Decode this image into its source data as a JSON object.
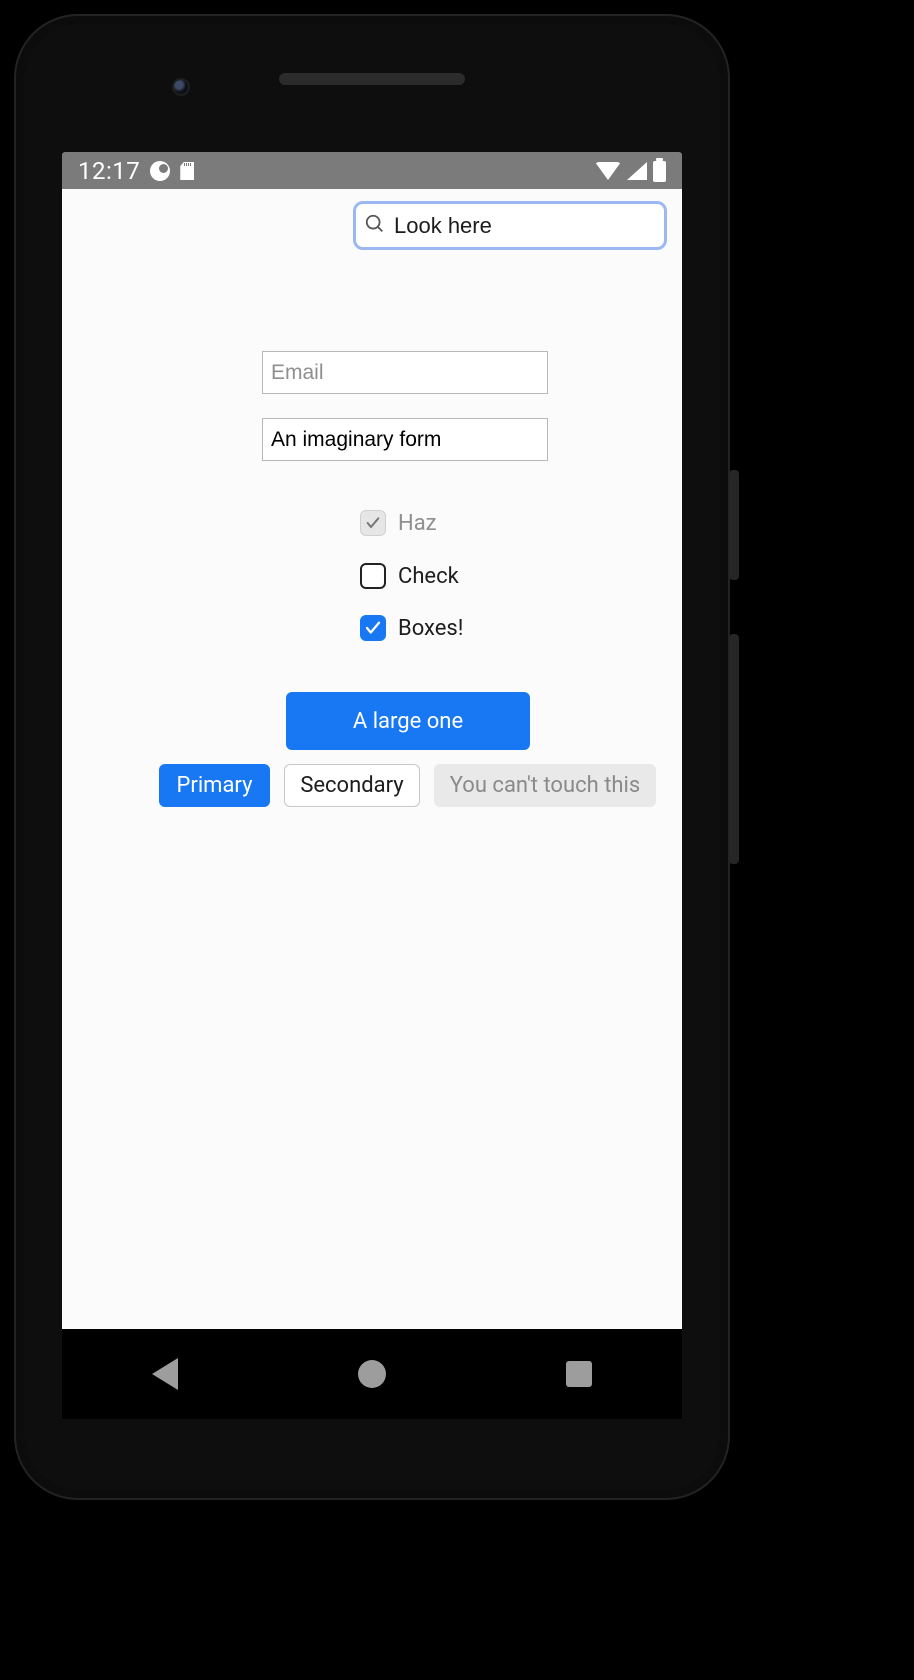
{
  "status": {
    "time": "12:17"
  },
  "search": {
    "value": "Look here"
  },
  "form": {
    "email_placeholder": "Email",
    "email_value": "",
    "desc_value": "An imaginary form"
  },
  "checkboxes": [
    {
      "label": "Haz",
      "checked": true,
      "disabled": true
    },
    {
      "label": "Check",
      "checked": false,
      "disabled": false
    },
    {
      "label": "Boxes!",
      "checked": true,
      "disabled": false
    }
  ],
  "buttons": {
    "large": "A large one",
    "primary": "Primary",
    "secondary": "Secondary",
    "disabled": "You can't touch this"
  }
}
